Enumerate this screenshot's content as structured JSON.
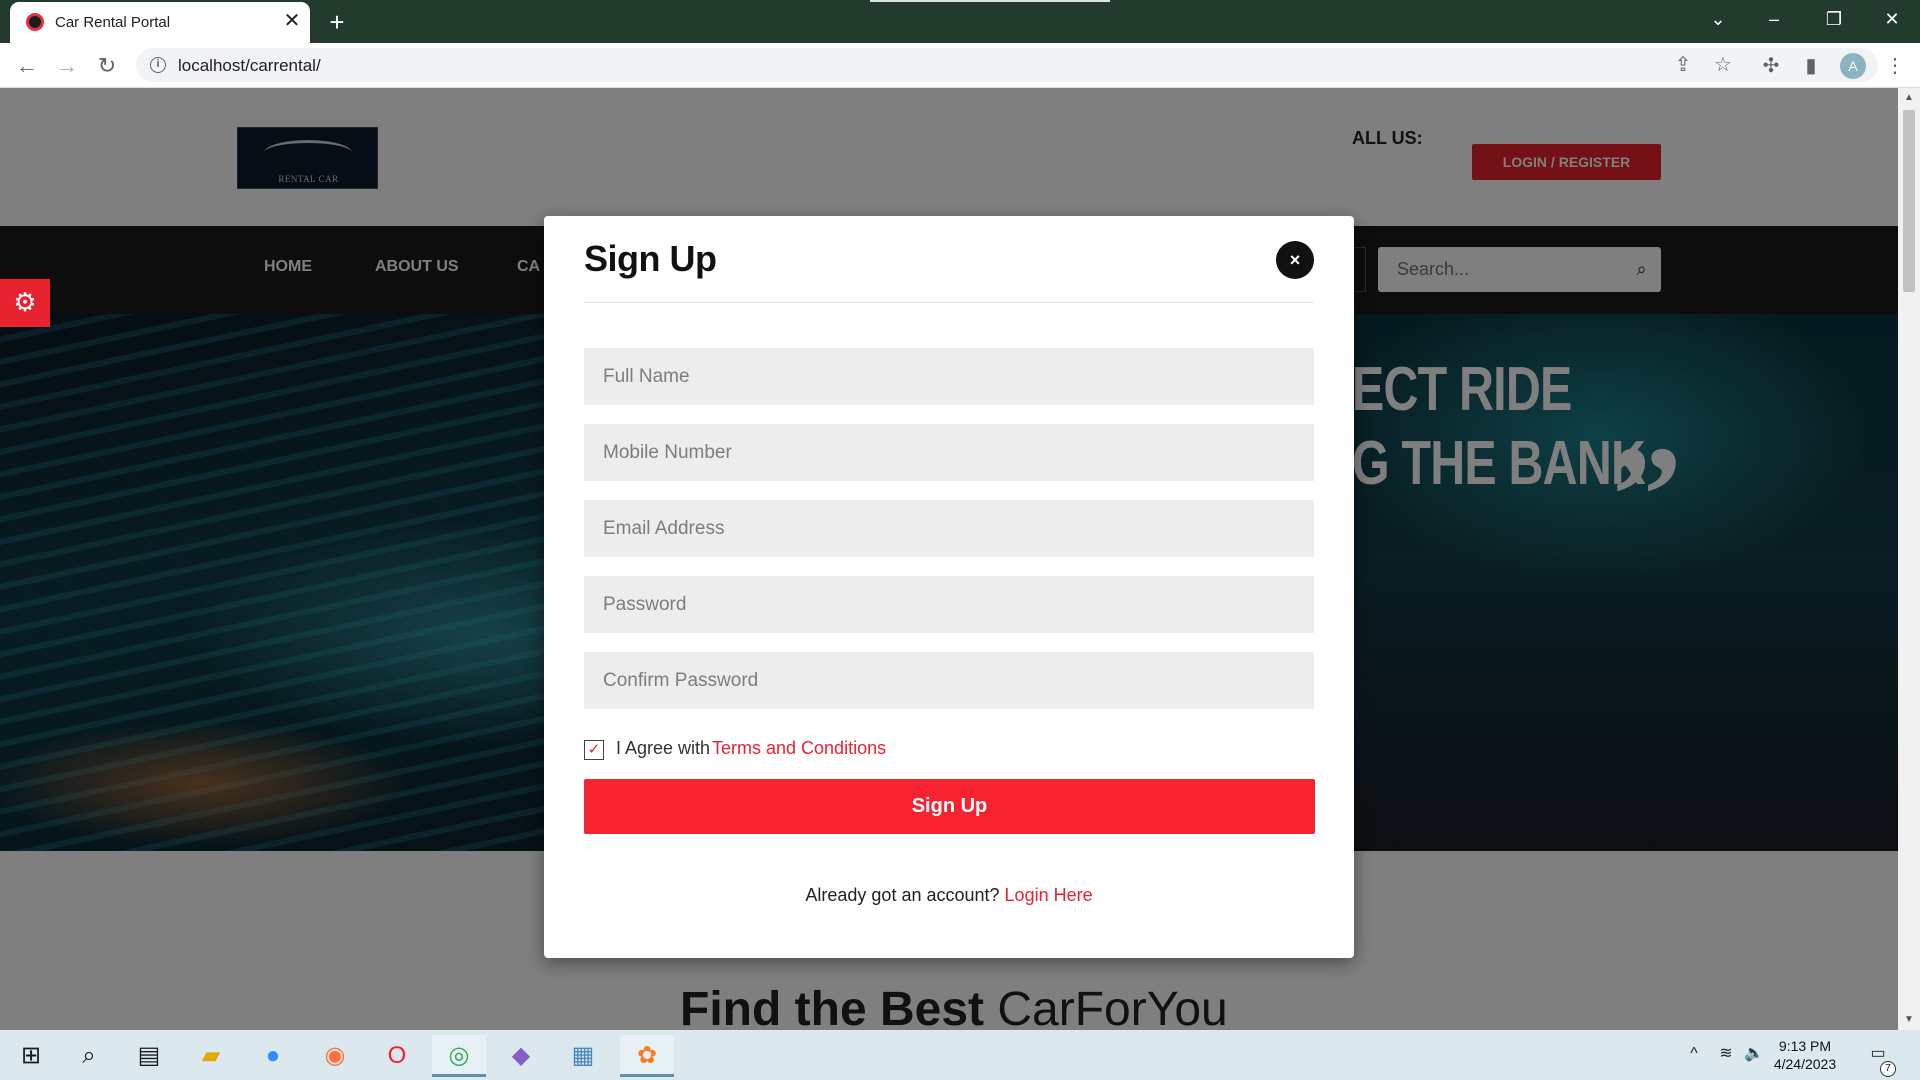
{
  "browser": {
    "tab_title": "Car Rental Portal",
    "tab_close": "✕",
    "new_tab": "+",
    "url": "localhost/carrental/",
    "profile_initial": "A"
  },
  "site": {
    "logo_text": "RENTAL CAR",
    "call_us_label": "ALL US:",
    "login_register_label": "LOGIN / REGISTER",
    "nav": [
      "HOME",
      "ABOUT US",
      "CA"
    ],
    "search_placeholder": "Search...",
    "hero_line1": "ECT RIDE",
    "hero_line2": "G THE BANK",
    "hero_quote": "”",
    "below_title_bold": "Find the Best",
    "below_title_light": "CarForYou"
  },
  "modal": {
    "title": "Sign Up",
    "close_label": "×",
    "fields": {
      "full_name_placeholder": "Full Name",
      "mobile_placeholder": "Mobile Number",
      "email_placeholder": "Email Address",
      "password_placeholder": "Password",
      "confirm_password_placeholder": "Confirm Password"
    },
    "agree_checked": true,
    "agree_check_glyph": "✓",
    "agree_text": "I Agree with",
    "terms_link": "Terms and Conditions",
    "submit_label": "Sign Up",
    "already_text": "Already got an account?",
    "login_link": "Login Here"
  },
  "taskbar": {
    "time": "9:13 PM",
    "date": "4/24/2023",
    "notification_count": "7",
    "apps": [
      "windows-start",
      "search",
      "task-view",
      "file-explorer",
      "zoom",
      "firefox",
      "opera",
      "chrome",
      "visual-studio",
      "notepad",
      "xampp"
    ]
  },
  "colors": {
    "accent_red": "#f6222f",
    "tab_strip": "#223b2d",
    "nav_bg": "#1a1a1a"
  }
}
